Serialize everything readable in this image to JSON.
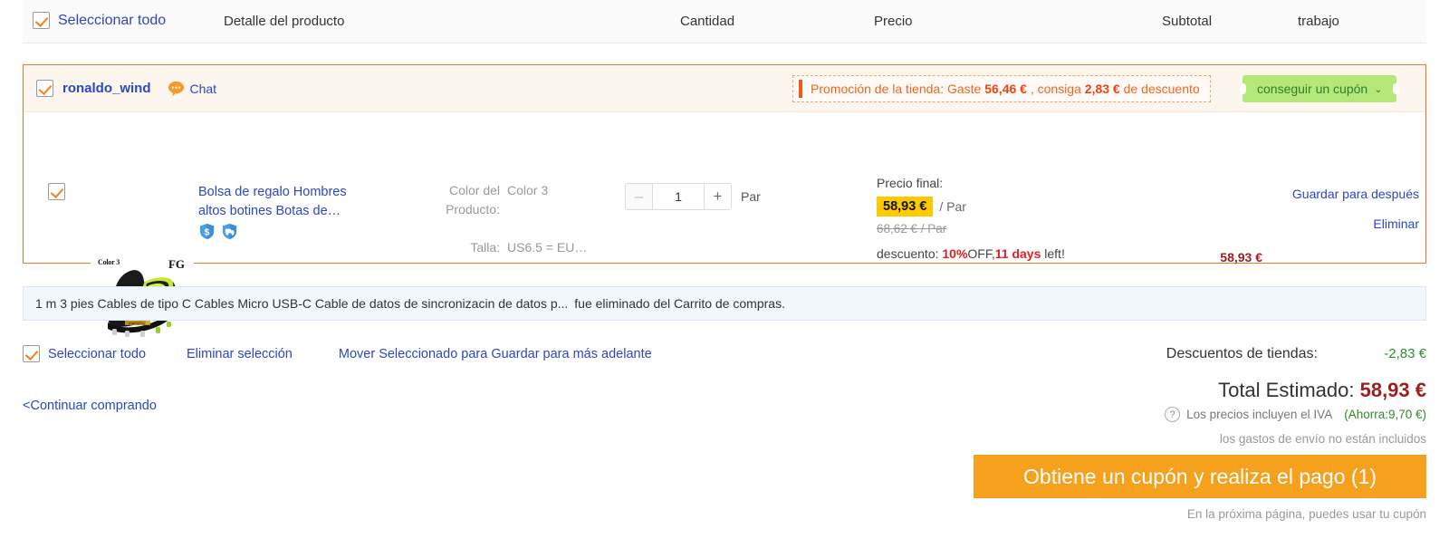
{
  "header": {
    "select_all": "Seleccionar todo",
    "col_detail": "Detalle del producto",
    "col_quantity": "Cantidad",
    "col_price": "Precio",
    "col_subtotal": "Subtotal",
    "col_action": "trabajo"
  },
  "store": {
    "name": "ronaldo_wind",
    "chat_label": "Chat",
    "promo_prefix": "Promoción de la tienda:  Gaste ",
    "promo_amount": "56,46 €",
    "promo_middle": " , consiga ",
    "promo_discount": "2,83 €",
    "promo_suffix": " de descuento",
    "coupon_button": "conseguir un cupón",
    "coupon_caret": "⌄"
  },
  "item": {
    "thumb_color_tag": "Color 3",
    "thumb_fg_tag": "FG",
    "title": "Bolsa de regalo Hombres altos botines Botas de…",
    "badges": [
      "shield-dollar-icon",
      "shield-shipping-icon"
    ],
    "attr_color_key": "Color del Producto:",
    "attr_color_value": "Color 3",
    "attr_size_key": "Talla:",
    "attr_size_value": "US6.5 = EU…",
    "qty_minus": "–",
    "qty_value": "1",
    "qty_plus": "+",
    "qty_unit": "Par",
    "price_final_label": "Precio final:",
    "price_now": "58,93 €",
    "price_unit": "/ Par",
    "price_old": "68,62 € / Par",
    "discount_label": "descuento: ",
    "discount_pct": "10%",
    "discount_off": "OFF,",
    "discount_days": "11 days",
    "discount_left": " left!",
    "subtotal": "58,93 €",
    "save_for_later": "Guardar para después",
    "remove": "Eliminar"
  },
  "notice": {
    "product": "1 m 3 pies Cables de tipo C Cables Micro USB-C Cable de datos de sincronizacin de datos p...",
    "message": "fue eliminado del Carrito de compras."
  },
  "bottom": {
    "select_all": "Seleccionar todo",
    "delete_selection": "Eliminar selección",
    "move_to_saved": "Mover Seleccionado para Guardar para más adelante",
    "continue_shopping": "<Continuar comprando"
  },
  "summary": {
    "store_discount_label": "Descuentos de tiendas:",
    "store_discount_value": "-2,83 €",
    "total_label": "Total Estimado: ",
    "total_value": "58,93 €",
    "vat_icon": "?",
    "vat_text": "Los precios incluyen el IVA",
    "vat_saving": "(Ahorra:9,70 €)",
    "shipping_note": "los gastos de envío no están incluidos",
    "pay_button": "Obtiene un cupón y realiza el pago (1)",
    "pay_note": "En la próxima página, puedes usar tu cupón"
  },
  "colors": {
    "accent_orange": "#ee7722",
    "link_blue": "#2b47c6",
    "price_red": "#9c1f1f",
    "coupon_green": "#b4e878",
    "pay_orange": "#f5a11e"
  }
}
